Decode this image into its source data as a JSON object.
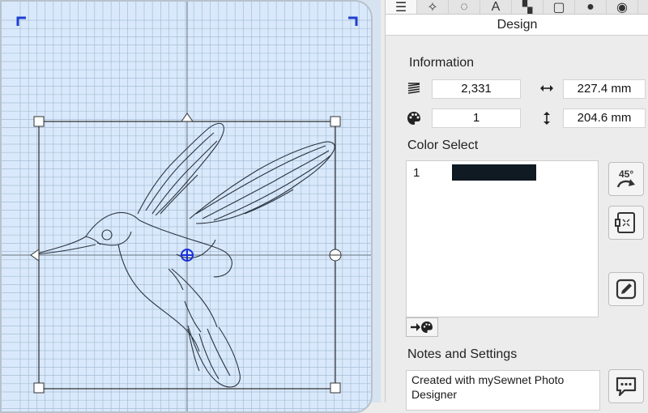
{
  "toolbar": {
    "tabs": [
      {
        "icon": "list-icon",
        "glyph": "☰"
      },
      {
        "icon": "sparkle-icon",
        "glyph": "✧"
      },
      {
        "icon": "dotted-circle-icon",
        "glyph": "◌"
      },
      {
        "icon": "letter-a-icon",
        "glyph": "A"
      },
      {
        "icon": "fabric-icon",
        "glyph": "▚"
      },
      {
        "icon": "hoop-icon",
        "glyph": "▢"
      },
      {
        "icon": "sphere-icon",
        "glyph": "●"
      },
      {
        "icon": "more-icon",
        "glyph": "◉"
      }
    ]
  },
  "design": {
    "header": "Design"
  },
  "information": {
    "title": "Information",
    "stitches": "2,331",
    "width": "227.4 mm",
    "colors": "1",
    "height": "204.6 mm"
  },
  "color_select": {
    "title": "Color Select",
    "items": [
      {
        "number": "1",
        "color": "#0f1a22"
      }
    ]
  },
  "notes": {
    "title": "Notes and Settings",
    "text": "Created with mySewnet Photo Designer"
  },
  "colors": {
    "hoop_fill": "#d9e9fb",
    "grid_minor": "#a7bed6",
    "grid_major": "#7f8a95",
    "selection": "#2a2a2a",
    "center_marker": "#1a2fd6",
    "corner_marker": "#1d3fd0"
  }
}
